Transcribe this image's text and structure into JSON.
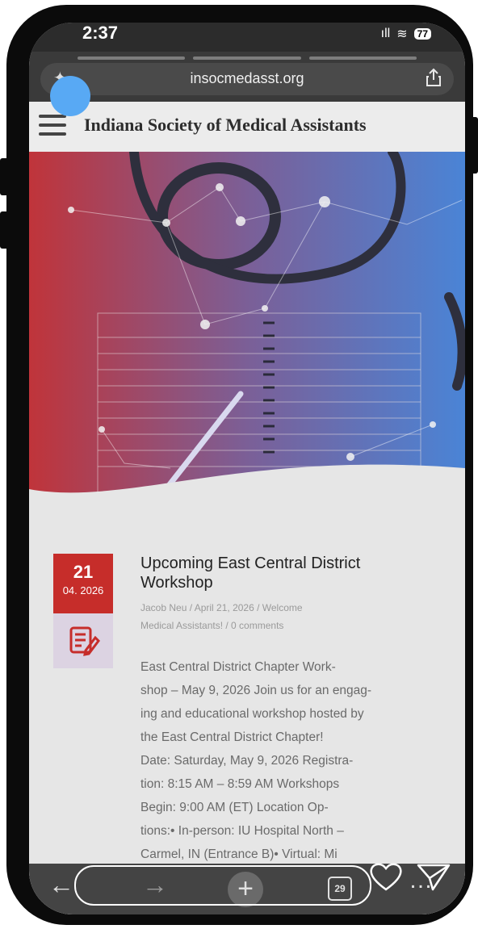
{
  "status_bar": {
    "time": "2:37",
    "signal": "ıll",
    "wifi": "≋",
    "battery": "77"
  },
  "browser": {
    "url": "insocmedasst.org",
    "tab_count": "29"
  },
  "site": {
    "title": "Indiana Society of Medical Assistants"
  },
  "post": {
    "day": "21",
    "month_year": "04. 2026",
    "title": "Upcoming East Central District Workshop",
    "meta_line_1": "Jacob Neu / April 21, 2026 / Welcome",
    "meta_line_2": "Medical Assistants! / 0 comments",
    "body": [
      "East Central District Chapter Work-",
      "shop – May 9, 2026 Join us for an engag-",
      "ing and educational workshop hosted by",
      "the East Central District Chapter!",
      "Date: Saturday, May 9, 2026 Registra-",
      "tion: 8:15 AM – 8:59 AM Workshops",
      "Begin: 9:00 AM (ET) Location Op-",
      "tions:• In-person: IU Hospital North –",
      "Carmel, IN (Entrance B)• Virtual: Mi"
    ]
  },
  "colors": {
    "accent_red": "#c62d2a",
    "hero_red": "#c0343a",
    "hero_blue": "#4a84d6",
    "touch_dot": "#58a9f4"
  }
}
